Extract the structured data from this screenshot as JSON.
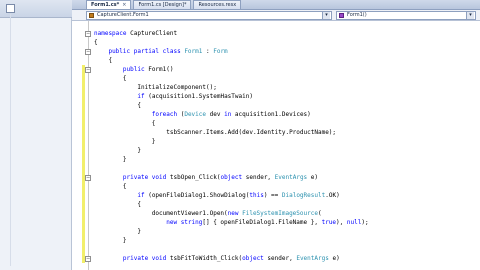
{
  "tabs": [
    {
      "label": "Form1.cs*",
      "active": true
    },
    {
      "label": "Form1.cs [Design]*",
      "active": false
    },
    {
      "label": "Resources.resx",
      "active": false
    }
  ],
  "nav": {
    "class_combo": "CaptureClient.Form1",
    "member_combo": "Form1()"
  },
  "code_lines": [
    [
      {
        "t": "namespace ",
        "c": "kw"
      },
      {
        "t": "CaptureClient"
      }
    ],
    [
      {
        "t": "{"
      }
    ],
    [
      {
        "t": "    "
      },
      {
        "t": "public partial class ",
        "c": "kw"
      },
      {
        "t": "Form1",
        "c": "ty"
      },
      {
        "t": " : "
      },
      {
        "t": "Form",
        "c": "ty"
      }
    ],
    [
      {
        "t": "    {"
      }
    ],
    [
      {
        "t": "        "
      },
      {
        "t": "public ",
        "c": "kw"
      },
      {
        "t": "Form1()"
      }
    ],
    [
      {
        "t": "        {"
      }
    ],
    [
      {
        "t": "            InitializeComponent();"
      }
    ],
    [
      {
        "t": "            "
      },
      {
        "t": "if",
        "c": "kw"
      },
      {
        "t": " (acquisition1.SystemHasTwain)"
      }
    ],
    [
      {
        "t": "            {"
      }
    ],
    [
      {
        "t": "                "
      },
      {
        "t": "foreach",
        "c": "kw"
      },
      {
        "t": " ("
      },
      {
        "t": "Device",
        "c": "ty"
      },
      {
        "t": " dev "
      },
      {
        "t": "in",
        "c": "kw"
      },
      {
        "t": " acquisition1.Devices)"
      }
    ],
    [
      {
        "t": "                {"
      }
    ],
    [
      {
        "t": "                    tsbScanner.Items.Add(dev.Identity.ProductName);"
      }
    ],
    [
      {
        "t": "                }"
      }
    ],
    [
      {
        "t": "            }"
      }
    ],
    [
      {
        "t": "        }"
      }
    ],
    [
      {
        "t": ""
      }
    ],
    [
      {
        "t": "        "
      },
      {
        "t": "private void ",
        "c": "kw"
      },
      {
        "t": "tsbOpen_Click("
      },
      {
        "t": "object",
        "c": "kw"
      },
      {
        "t": " sender, "
      },
      {
        "t": "EventArgs",
        "c": "ty"
      },
      {
        "t": " e)"
      }
    ],
    [
      {
        "t": "        {"
      }
    ],
    [
      {
        "t": "            "
      },
      {
        "t": "if",
        "c": "kw"
      },
      {
        "t": " (openFileDialog1.ShowDialog("
      },
      {
        "t": "this",
        "c": "kw"
      },
      {
        "t": ") == "
      },
      {
        "t": "DialogResult",
        "c": "ty"
      },
      {
        "t": ".OK)"
      }
    ],
    [
      {
        "t": "            {"
      }
    ],
    [
      {
        "t": "                documentViewer1.Open("
      },
      {
        "t": "new ",
        "c": "kw"
      },
      {
        "t": "FileSystemImageSource",
        "c": "ty"
      },
      {
        "t": "("
      }
    ],
    [
      {
        "t": "                    "
      },
      {
        "t": "new string",
        "c": "kw"
      },
      {
        "t": "[] { openFileDialog1.FileName }, "
      },
      {
        "t": "true",
        "c": "kw"
      },
      {
        "t": "), "
      },
      {
        "t": "null",
        "c": "kw"
      },
      {
        "t": ");"
      }
    ],
    [
      {
        "t": "            }"
      }
    ],
    [
      {
        "t": "        }"
      }
    ],
    [
      {
        "t": ""
      }
    ],
    [
      {
        "t": "        "
      },
      {
        "t": "private void ",
        "c": "kw"
      },
      {
        "t": "tsbFitToWidth_Click("
      },
      {
        "t": "object",
        "c": "kw"
      },
      {
        "t": " sender, "
      },
      {
        "t": "EventArgs",
        "c": "ty"
      },
      {
        "t": " e)"
      }
    ]
  ]
}
